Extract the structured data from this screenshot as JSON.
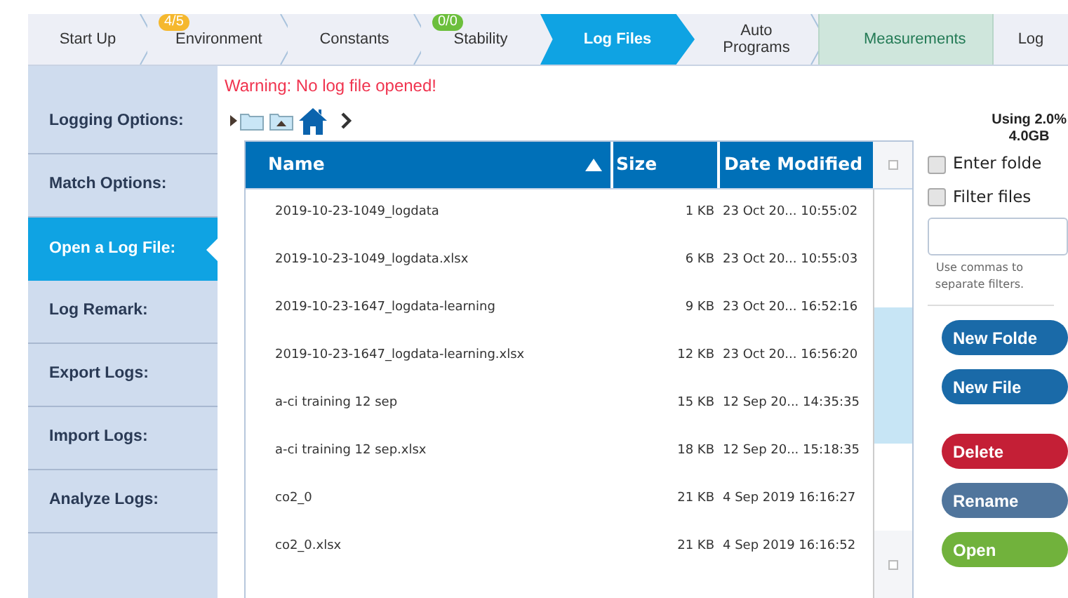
{
  "tabs": [
    {
      "label": "Start Up",
      "selected": false,
      "highlighted": false
    },
    {
      "label": "Environment",
      "selected": false,
      "highlighted": false,
      "badge": {
        "text": "4/5",
        "color": "#f5b82e"
      }
    },
    {
      "label": "Constants",
      "selected": false,
      "highlighted": false
    },
    {
      "label": "Stability",
      "selected": false,
      "highlighted": false,
      "badge": {
        "text": "0/0",
        "color": "#6cbf3c"
      }
    },
    {
      "label": "Log Files",
      "selected": true,
      "highlighted": false
    },
    {
      "label": "Auto Programs",
      "selected": false,
      "highlighted": false
    },
    {
      "label": "Measurements",
      "selected": false,
      "highlighted": true
    },
    {
      "label": "Log",
      "selected": false,
      "highlighted": false
    }
  ],
  "sidebar": {
    "items": [
      {
        "label": "Logging Options:",
        "selected": false
      },
      {
        "label": "Match Options:",
        "selected": false
      },
      {
        "label": "Open a Log File:",
        "selected": true
      },
      {
        "label": "Log Remark:",
        "selected": false
      },
      {
        "label": "Export Logs:",
        "selected": false
      },
      {
        "label": "Import Logs:",
        "selected": false
      },
      {
        "label": "Analyze Logs:",
        "selected": false
      }
    ]
  },
  "warning": "Warning: No log file opened!",
  "table": {
    "columns": [
      "Name",
      "Size",
      "Date Modified"
    ],
    "rows": [
      [
        "2019-10-23-1049_logdata",
        "1 KB",
        "23 Oct 20... 10:55:02"
      ],
      [
        "2019-10-23-1049_logdata.xlsx",
        "6 KB",
        "23 Oct 20... 10:55:03"
      ],
      [
        "2019-10-23-1647_logdata-learning",
        "9 KB",
        "23 Oct 20... 16:52:16"
      ],
      [
        "2019-10-23-1647_logdata-learning.xlsx",
        "12 KB",
        "23 Oct 20... 16:56:20"
      ],
      [
        "a-ci training 12 sep",
        "15 KB",
        "12 Sep 20... 14:35:35"
      ],
      [
        "a-ci training 12 sep.xlsx",
        "18 KB",
        "12 Sep 20... 15:18:35"
      ],
      [
        "co2_0",
        "21 KB",
        "4 Sep 2019 16:16:27"
      ],
      [
        "co2_0.xlsx",
        "21 KB",
        "4 Sep 2019 16:16:52"
      ]
    ]
  },
  "storage": [
    "Using 2.0%",
    "4.0GB"
  ],
  "options": [
    {
      "label": "Enter folde",
      "checked": false
    },
    {
      "label": "Filter files",
      "checked": false
    }
  ],
  "filter_hint": "Use commas to separate filters.",
  "buttons": [
    {
      "label": "New Folde",
      "kind": "primary"
    },
    {
      "label": "New File",
      "kind": "primary"
    },
    {
      "label": "Delete",
      "kind": "danger"
    },
    {
      "label": "Rename",
      "kind": "secondary"
    },
    {
      "label": "Open",
      "kind": "success"
    }
  ]
}
